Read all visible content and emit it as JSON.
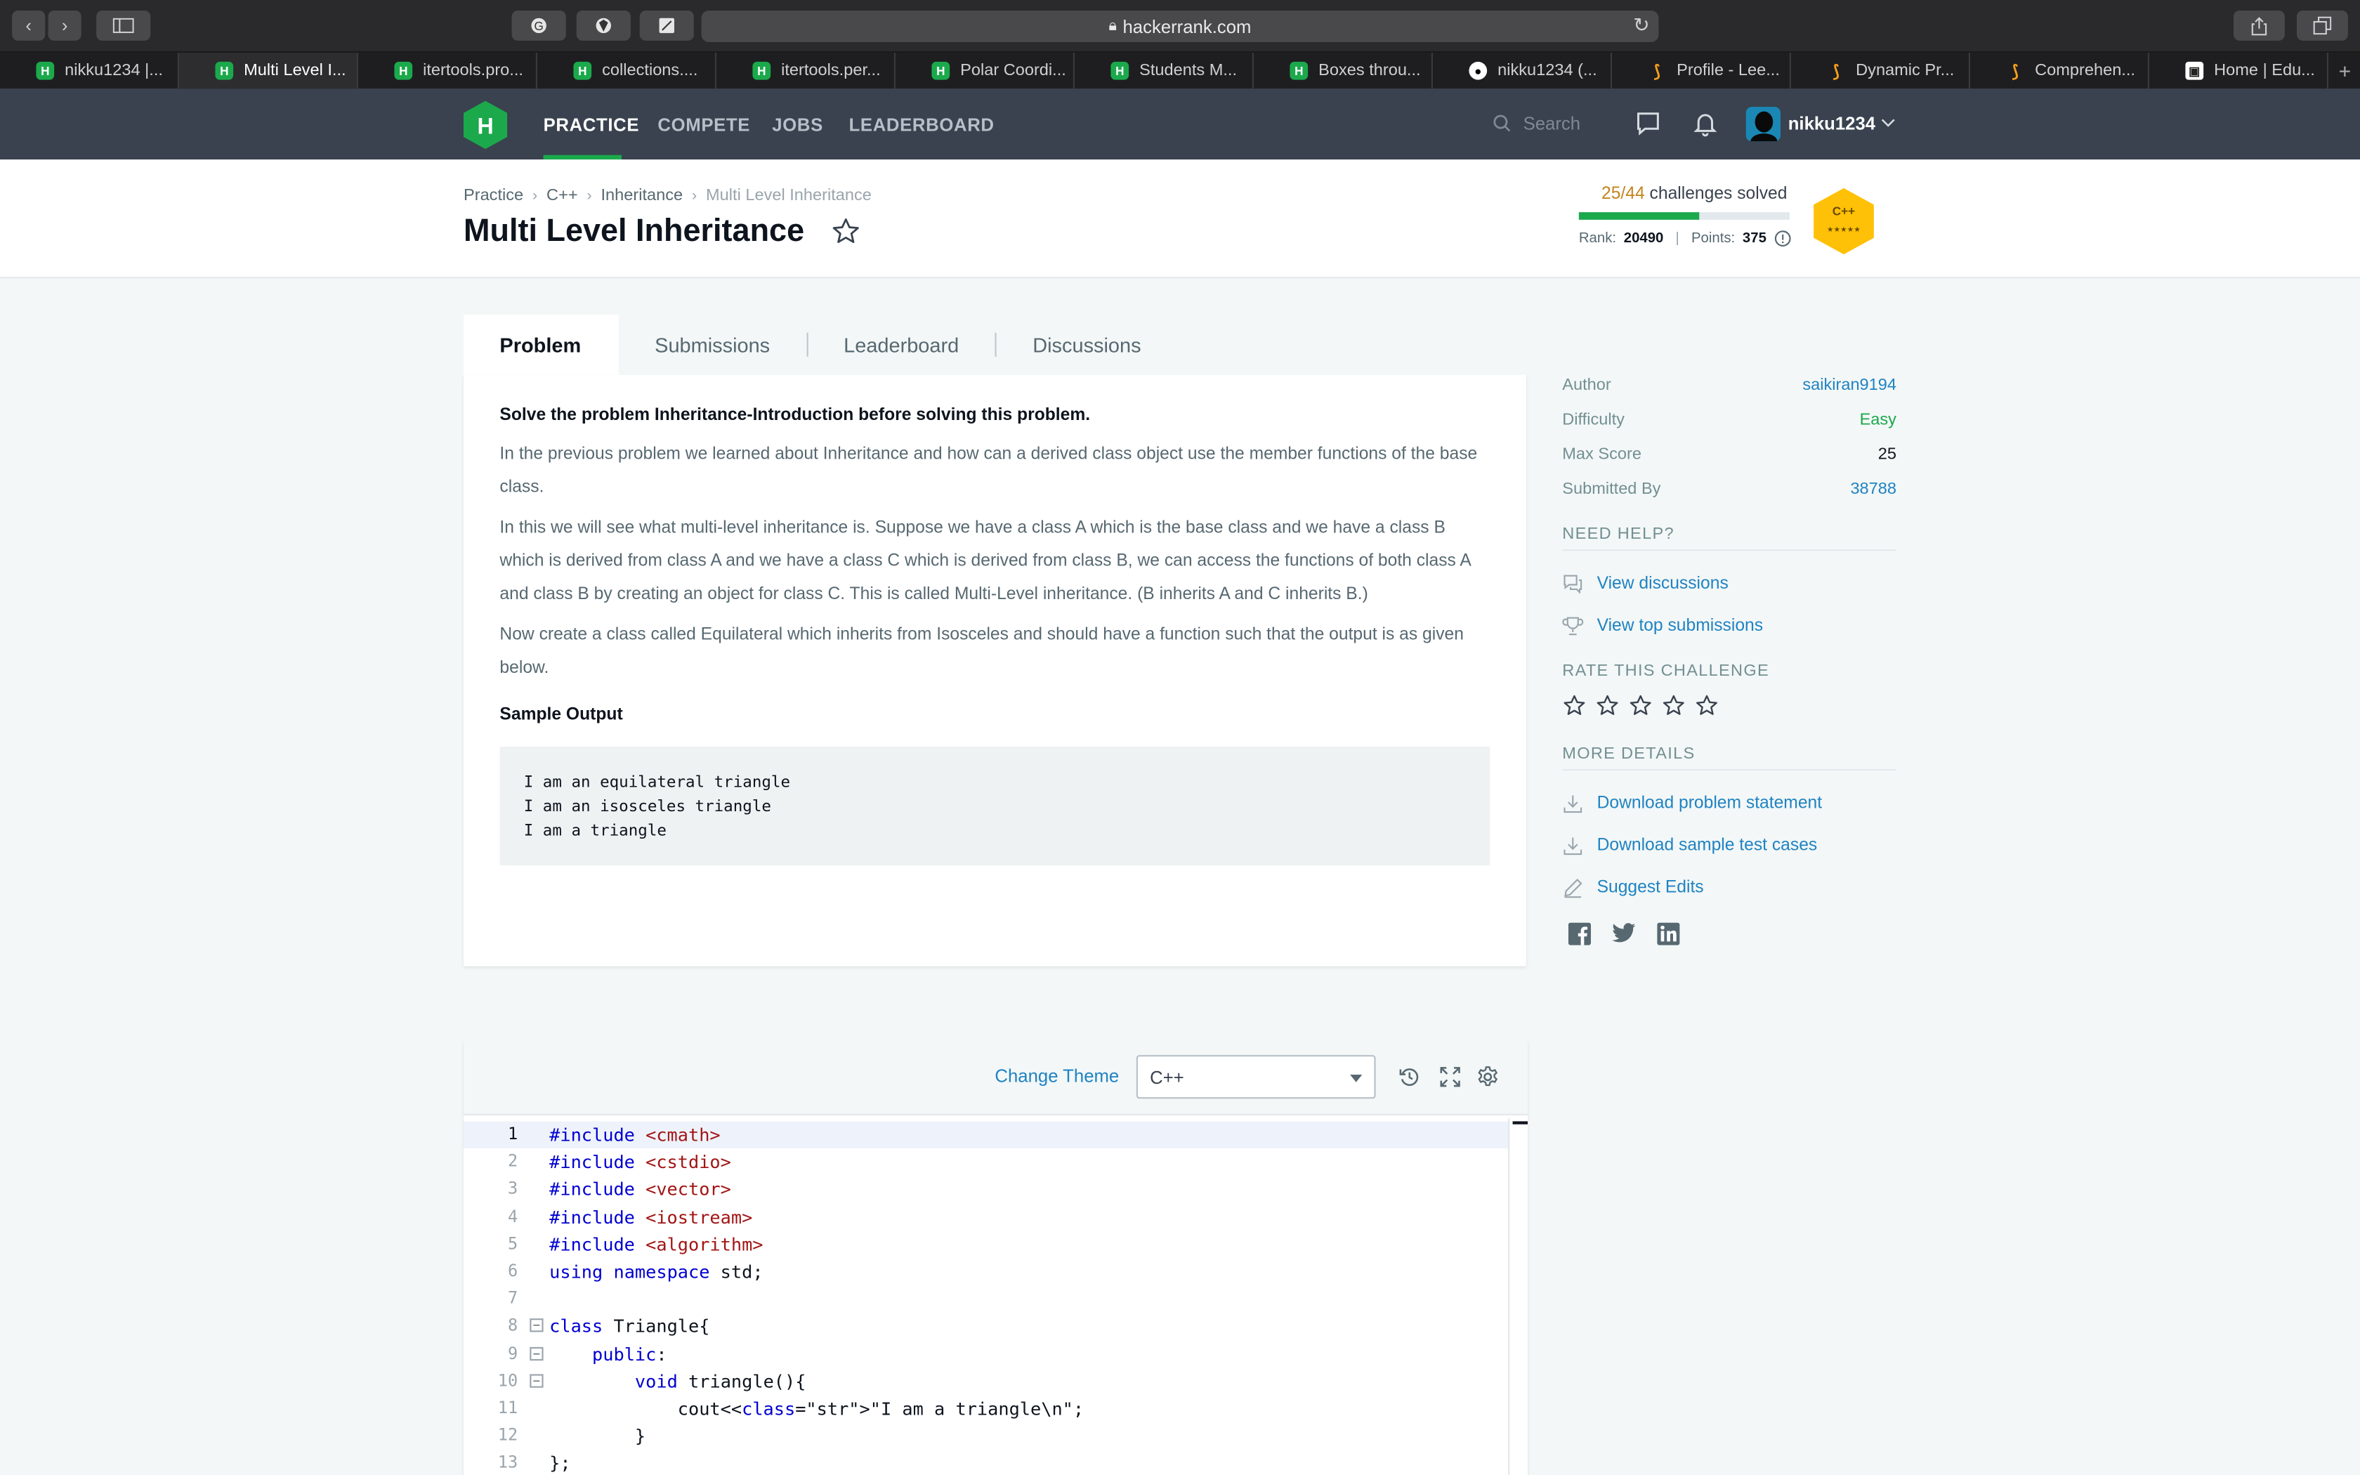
{
  "browser": {
    "url": "hackerrank.com",
    "tabs": [
      {
        "label": "nikku1234 |...",
        "icon": "hackerrank-icon",
        "active": false
      },
      {
        "label": "Multi Level I...",
        "icon": "hackerrank-icon",
        "active": true
      },
      {
        "label": "itertools.pro...",
        "icon": "hackerrank-icon",
        "active": false
      },
      {
        "label": "collections....",
        "icon": "hackerrank-icon",
        "active": false
      },
      {
        "label": "itertools.per...",
        "icon": "hackerrank-icon",
        "active": false
      },
      {
        "label": "Polar Coordi...",
        "icon": "hackerrank-icon",
        "active": false
      },
      {
        "label": "Students M...",
        "icon": "hackerrank-icon",
        "active": false
      },
      {
        "label": "Boxes throu...",
        "icon": "hackerrank-icon",
        "active": false
      },
      {
        "label": "nikku1234 (...",
        "icon": "github-icon",
        "active": false
      },
      {
        "label": "Profile - Lee...",
        "icon": "leetcode-icon",
        "active": false
      },
      {
        "label": "Dynamic Pr...",
        "icon": "leetcode-icon",
        "active": false
      },
      {
        "label": "Comprehen...",
        "icon": "leetcode-icon",
        "active": false
      },
      {
        "label": "Home | Edu...",
        "icon": "educative-icon",
        "active": false
      }
    ]
  },
  "nav": {
    "links": [
      "PRACTICE",
      "COMPETE",
      "JOBS",
      "LEADERBOARD"
    ],
    "active": "PRACTICE",
    "search_placeholder": "Search",
    "username": "nikku1234"
  },
  "header": {
    "breadcrumbs": [
      "Practice",
      "C++",
      "Inheritance",
      "Multi Level Inheritance"
    ],
    "title": "Multi Level Inheritance",
    "solved_count": "25/44",
    "solved_label": "challenges solved",
    "solved_fraction": 0.568,
    "rank_label": "Rank:",
    "rank": "20490",
    "points_label": "Points:",
    "points": "375",
    "badge_text": "C++",
    "badge_color": "#ffc107"
  },
  "problem_tabs": [
    "Problem",
    "Submissions",
    "Leaderboard",
    "Discussions"
  ],
  "problem": {
    "intro": "Solve the problem Inheritance-Introduction before solving this problem.",
    "para1": "In the previous problem we learned about Inheritance and how can a derived class object use the member functions of the base class.",
    "para2": "In this we will see what multi-level inheritance is. Suppose we have a class A which is the base class and we have a class B which is derived from class A and we have a class C which is derived from class B, we can access the functions of both class A and class B by creating an object for class C. This is called Multi-Level inheritance. (B inherits A and C inherits B.)",
    "para3": "Now create a class called Equilateral which inherits from Isosceles and should have a function such that the output is as given below.",
    "sample_heading": "Sample Output",
    "sample_lines": [
      "I am an equilateral triangle",
      "I am an isosceles triangle",
      "I am a triangle"
    ]
  },
  "sidebar": {
    "author_label": "Author",
    "author": "saikiran9194",
    "difficulty_label": "Difficulty",
    "difficulty": "Easy",
    "max_score_label": "Max Score",
    "max_score": "25",
    "submitted_by_label": "Submitted By",
    "submitted_by": "38788",
    "need_help": "NEED HELP?",
    "view_discussions": "View discussions",
    "view_top_submissions": "View top submissions",
    "rate": "RATE THIS CHALLENGE",
    "rating": 0,
    "more_details": "MORE DETAILS",
    "download_statement": "Download problem statement",
    "download_tests": "Download sample test cases",
    "suggest_edits": "Suggest Edits"
  },
  "editor": {
    "change_theme": "Change Theme",
    "language": "C++",
    "lines": [
      "#include <cmath>",
      "#include <cstdio>",
      "#include <vector>",
      "#include <iostream>",
      "#include <algorithm>",
      "using namespace std;",
      "",
      "class Triangle{",
      "    public:",
      "        void triangle(){",
      "            cout<<\"I am a triangle\\n\";",
      "        }",
      "};"
    ]
  }
}
